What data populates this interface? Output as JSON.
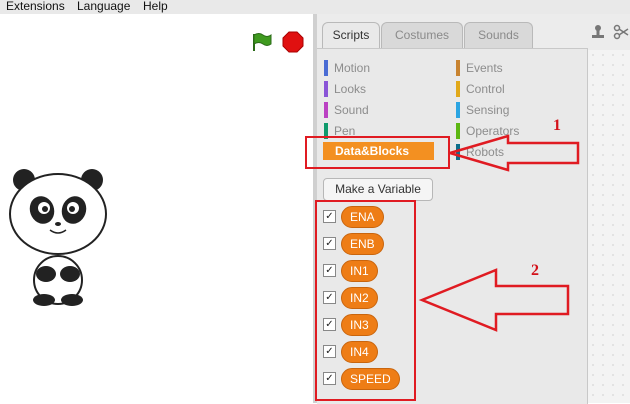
{
  "menu": [
    "Extensions",
    "Language",
    "Help"
  ],
  "tabs": [
    {
      "label": "Scripts",
      "active": true
    },
    {
      "label": "Costumes",
      "active": false
    },
    {
      "label": "Sounds",
      "active": false
    }
  ],
  "categories_left": [
    {
      "label": "Motion",
      "color": "#4a6cd4"
    },
    {
      "label": "Looks",
      "color": "#8a55d7"
    },
    {
      "label": "Sound",
      "color": "#bb42c3"
    },
    {
      "label": "Pen",
      "color": "#0e9a6c"
    }
  ],
  "categories_right": [
    {
      "label": "Events",
      "color": "#c88330"
    },
    {
      "label": "Control",
      "color": "#e1a91a"
    },
    {
      "label": "Sensing",
      "color": "#2ca5e2"
    },
    {
      "label": "Operators",
      "color": "#5cb712"
    },
    {
      "label": "Robots",
      "color": "#0e6f8c"
    }
  ],
  "selected_category": {
    "label": "Data&Blocks",
    "color": "#f39021"
  },
  "make_variable_label": "Make a Variable",
  "variables": [
    {
      "name": "ENA",
      "checked": true
    },
    {
      "name": "ENB",
      "checked": true
    },
    {
      "name": "IN1",
      "checked": true
    },
    {
      "name": "IN2",
      "checked": true
    },
    {
      "name": "IN3",
      "checked": true
    },
    {
      "name": "IN4",
      "checked": true
    },
    {
      "name": "SPEED",
      "checked": true
    }
  ],
  "annotations": {
    "label1": "1",
    "label2": "2"
  },
  "colors": {
    "annotation_red": "#e01b22",
    "variable_block": "#ee7d16"
  }
}
